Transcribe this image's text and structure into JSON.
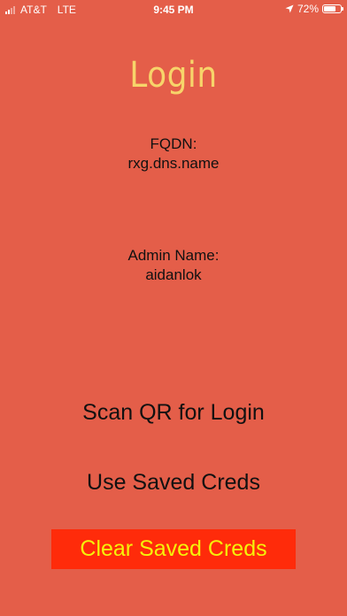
{
  "status_bar": {
    "carrier": "AT&T",
    "network": "LTE",
    "time": "9:45 PM",
    "battery_percent": "72%",
    "battery_level": 0.72
  },
  "page": {
    "title": "Login"
  },
  "fqdn": {
    "label": "FQDN:",
    "value": "rxg.dns.name"
  },
  "admin": {
    "label": "Admin Name:",
    "value": "aidanlok"
  },
  "actions": {
    "scan_label": "Scan QR for Login",
    "use_saved_label": "Use Saved Creds",
    "clear_label": "Clear Saved Creds"
  },
  "colors": {
    "background": "#E45E49",
    "title": "#F7D46A",
    "clear_button_bg": "#FF2B0A",
    "clear_button_text": "#F5F20A"
  }
}
